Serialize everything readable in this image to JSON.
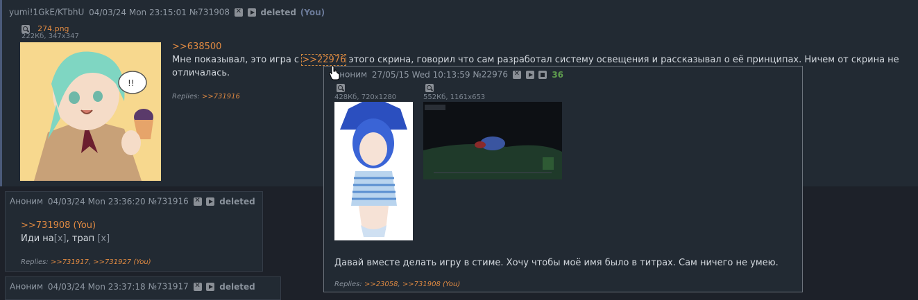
{
  "main_post": {
    "name": "yumi!1GkE/KTbhU",
    "date": "04/03/24 Mon 23:15:01",
    "number": "№731908",
    "deleted": "deleted",
    "you": "(You)",
    "file_name": "274.png",
    "file_meta": "222Кб, 347x347",
    "quote": ">>638500",
    "text_before": "Мне показывал, это игра с",
    "inline_link": ">>22976",
    "text_after_line1": "этого скрина, говорил что сам разработал систему освещения и рассказывал о её принципах. Ничем от скрина не",
    "text_line2": "отличалась.",
    "replies_label": "Replies:",
    "reply1": ">>731916"
  },
  "post2": {
    "name": "Аноним",
    "date": "04/03/24 Mon 23:36:20",
    "number": "№731916",
    "deleted": "deleted",
    "quote": ">>731908 (You)",
    "text_a": "Иди на",
    "spoiler1": "[x]",
    "text_b": ", трап",
    "spoiler2": "[x]",
    "replies_label": "Replies:",
    "reply1": ">>731917",
    "reply2": ">>731927 (You)"
  },
  "post3": {
    "name": "Аноним",
    "date": "04/03/24 Mon 23:37:18",
    "number": "№731917",
    "deleted": "deleted"
  },
  "popup": {
    "name": "Аноним",
    "date": "27/05/15 Wed 10:13:59",
    "number": "№22976",
    "count": "36",
    "file1_meta": "428Кб, 720x1280",
    "file2_meta": "552Кб, 1161x653",
    "text": "Давай вместе делать игру в стиме. Хочу чтобы моё имя было в титрах. Сам ничего не умею.",
    "replies_label": "Replies:",
    "reply1": ">>23058",
    "reply2": ">>731908 (You)"
  },
  "colors": {
    "background": "#1d2129",
    "post_bg": "#222a33",
    "link": "#e08a42",
    "count": "#5f9d4e"
  }
}
